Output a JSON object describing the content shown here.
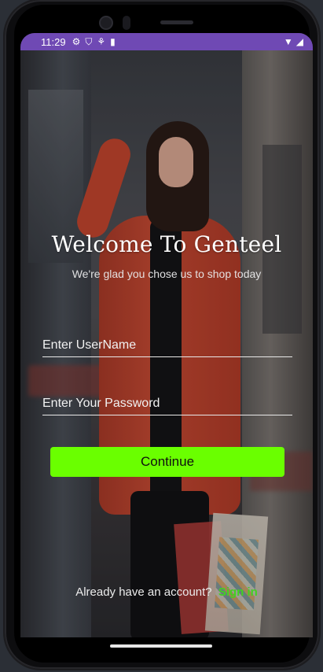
{
  "status_bar": {
    "time": "11:29",
    "icons": [
      "gear-icon",
      "shield-icon",
      "notification-icon",
      "sd-card-icon"
    ],
    "right_icons": [
      "wifi-icon",
      "signal-icon"
    ],
    "bg_color": "#6f49b4"
  },
  "login": {
    "title": "Welcome To Genteel",
    "subtitle": "We're glad you chose us to shop today",
    "username_placeholder": "Enter UserName",
    "password_placeholder": "Enter Your Password",
    "continue_label": "Continue",
    "account_prompt": "Already have an account?",
    "signin_label": "Sign in",
    "accent_color": "#6aff00",
    "signin_color": "#43d122"
  }
}
